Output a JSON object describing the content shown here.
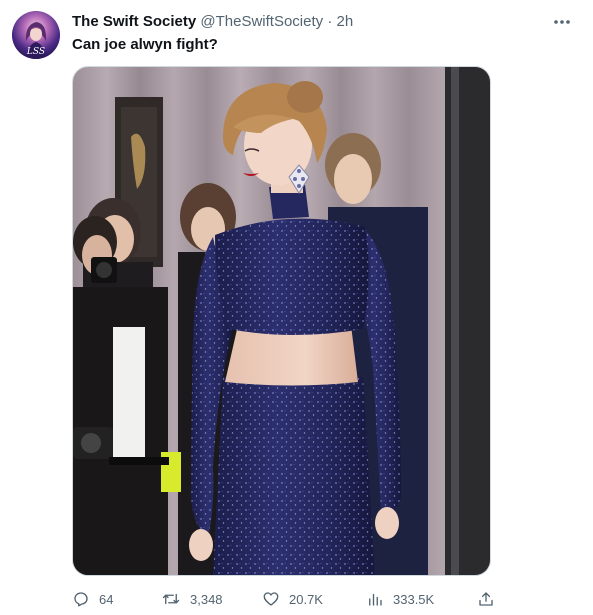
{
  "tweet": {
    "author": {
      "display_name": "The Swift Society",
      "handle": "@TheSwiftSociety",
      "separator": "·",
      "time": "2h",
      "avatar_text": "LSS"
    },
    "text": "Can joe alwyn fight?",
    "more_icon": "more-horizontal-icon"
  },
  "actions": {
    "reply": {
      "icon": "reply-icon",
      "count": "64"
    },
    "retweet": {
      "icon": "retweet-icon",
      "count": "3,348"
    },
    "like": {
      "icon": "heart-icon",
      "count": "20.7K"
    },
    "views": {
      "icon": "views-chart-icon",
      "count": "333.5K"
    },
    "share": {
      "icon": "share-icon"
    }
  },
  "colors": {
    "text_primary": "#0f1419",
    "text_secondary": "#536471",
    "border": "#cfd9de",
    "dress": "#24265e"
  }
}
